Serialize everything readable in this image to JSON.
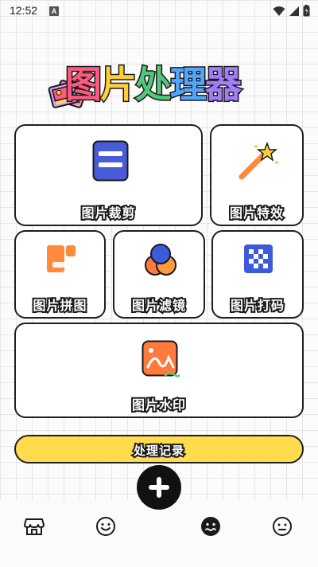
{
  "status_bar": {
    "time": "12:52",
    "notification_badge": "A"
  },
  "header": {
    "title": "图片处理器"
  },
  "tools": [
    {
      "label": "图片裁剪",
      "icon": "crop-icon"
    },
    {
      "label": "图片特效",
      "icon": "magic-wand-icon"
    },
    {
      "label": "图片拼图",
      "icon": "collage-icon"
    },
    {
      "label": "图片滤镜",
      "icon": "filter-icon"
    },
    {
      "label": "图片打码",
      "icon": "mosaic-icon"
    },
    {
      "label": "图片水印",
      "icon": "watermark-icon"
    }
  ],
  "history_button": {
    "label": "处理记录"
  },
  "bottom_nav": {
    "items": [
      {
        "icon": "store-icon"
      },
      {
        "icon": "smile-icon"
      },
      {
        "icon": "dizzy-face-icon",
        "active": true
      },
      {
        "icon": "neutral-face-icon"
      }
    ],
    "fab_icon": "plus-icon"
  },
  "colors": {
    "accent_yellow": "#ffdb4d",
    "crop_blue": "#4a5bd9",
    "orange": "#ff7a3d",
    "mosaic_blue": "#3b5bdb"
  }
}
